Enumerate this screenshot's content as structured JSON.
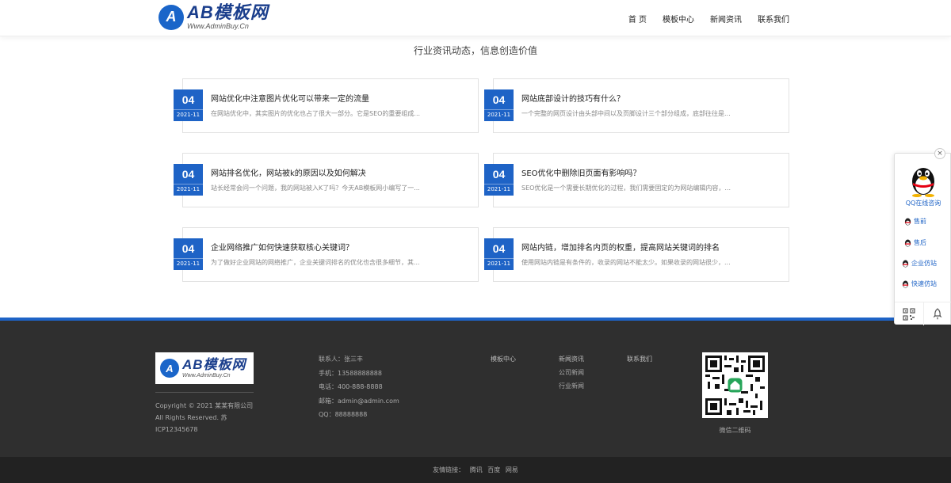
{
  "header": {
    "logo_title": "AB模板网",
    "logo_sub": "Www.AdminBuy.Cn",
    "nav": [
      "首 页",
      "模板中心",
      "新闻资讯",
      "联系我们"
    ]
  },
  "section": {
    "title": "行业资讯动态，信息创造价值"
  },
  "news": [
    {
      "day": "04",
      "month": "2021-11",
      "title": "网站优化中注意图片优化可以带来一定的流量",
      "desc": "在网站优化中，其实图片的优化也占了很大一部分。它是SEO的重要组成..."
    },
    {
      "day": "04",
      "month": "2021-11",
      "title": "网站底部设计的技巧有什么？",
      "desc": "一个完整的网页设计由头部中间以及页脚设计三个部分组成，底部往往是..."
    },
    {
      "day": "04",
      "month": "2021-11",
      "title": "网站排名优化，网站被k的原因以及如何解决",
      "desc": "站长经常会问一个问题，我的网站被入K了吗？今天AB模板网小编写了一..."
    },
    {
      "day": "04",
      "month": "2021-11",
      "title": "SEO优化中删除旧页面有影响吗？",
      "desc": "SEO优化是一个需要长期优化的过程，我们需要固定的为网站编辑内容，..."
    },
    {
      "day": "04",
      "month": "2021-11",
      "title": "企业网络推广如何快速获取核心关键词？",
      "desc": "为了做好企业网站的网络推广，企业关键词排名的优化也含很多细节，其..."
    },
    {
      "day": "04",
      "month": "2021-11",
      "title": "网站内链，增加排名内页的权重，提高网站关键词的排名",
      "desc": "使用网站内链是有条件的，收录的网站不能太少。如果收录的网站很少，..."
    }
  ],
  "footer": {
    "logo_title": "AB模板网",
    "logo_sub": "Www.AdminBuy.Cn",
    "copyright": "Copyright © 2021 某某有限公司 All Rights Reserved. 苏ICP12345678",
    "contact": [
      "联系人：张三丰",
      "手机：13588888888",
      "电话：400-888-8888",
      "邮箱：admin@admin.com",
      "QQ：88888888"
    ],
    "col1_head": "模板中心",
    "col2_head": "新闻资讯",
    "col2_items": [
      "公司新闻",
      "行业新闻"
    ],
    "col3_head": "联系我们",
    "qr_label": "微信二维码",
    "links_label": "友情链接：",
    "links": [
      "腾讯",
      "百度",
      "网易"
    ]
  },
  "qq_widget": {
    "online": "QQ在线咨询",
    "items": [
      "售前",
      "售后",
      "企业仿站",
      "快速仿站"
    ],
    "close": "×"
  }
}
